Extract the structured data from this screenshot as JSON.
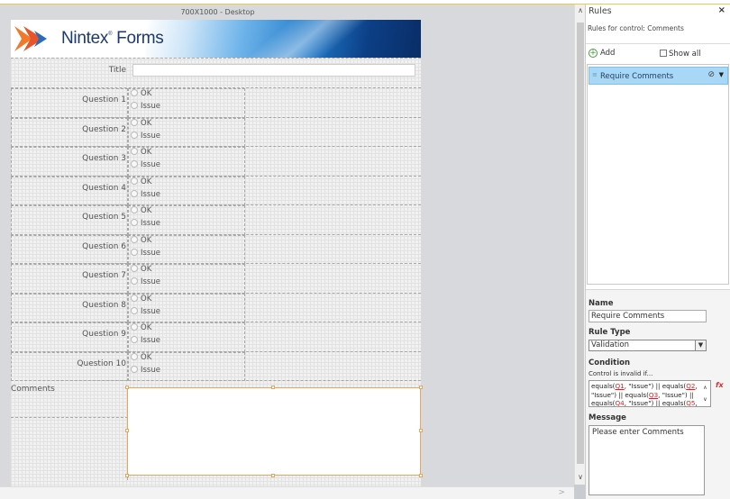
{
  "canvas": {
    "size_label": "700X1000 - Desktop",
    "logo_text": "Nintex",
    "logo_text2": "Forms",
    "logo_tm": "®"
  },
  "form": {
    "title_label": "Title",
    "questions": [
      {
        "label": "Question 1",
        "options": [
          "OK",
          "Issue"
        ]
      },
      {
        "label": "Question 2",
        "options": [
          "OK",
          "Issue"
        ]
      },
      {
        "label": "Question 3",
        "options": [
          "OK",
          "Issue"
        ]
      },
      {
        "label": "Question 4",
        "options": [
          "OK",
          "Issue"
        ]
      },
      {
        "label": "Question 5",
        "options": [
          "OK",
          "Issue"
        ]
      },
      {
        "label": "Question 6",
        "options": [
          "OK",
          "Issue"
        ]
      },
      {
        "label": "Question 7",
        "options": [
          "OK",
          "Issue"
        ]
      },
      {
        "label": "Question 8",
        "options": [
          "OK",
          "Issue"
        ]
      },
      {
        "label": "Question 9",
        "options": [
          "OK",
          "Issue"
        ]
      },
      {
        "label": "Question 10",
        "options": [
          "OK",
          "Issue"
        ]
      }
    ],
    "comments_label": "Comments"
  },
  "panel": {
    "title": "Rules",
    "close": "×",
    "rules_for": "Rules for control: Comments",
    "add_label": "Add",
    "show_all_label": "Show all",
    "rules": [
      {
        "name": "Require Comments"
      }
    ],
    "name_label": "Name",
    "name_value": "Require Comments",
    "rule_type_label": "Rule Type",
    "rule_type_value": "Validation",
    "condition_label": "Condition",
    "condition_hint": "Control is invalid if...",
    "condition_parts": [
      {
        "t": "equals(",
        "ref": false
      },
      {
        "t": "Q1",
        "ref": true
      },
      {
        "t": ", \"Issue\") || equals(",
        "ref": false
      },
      {
        "t": "Q2",
        "ref": true
      },
      {
        "t": ", \"Issue\") || equals(",
        "ref": false
      },
      {
        "t": "Q3",
        "ref": true
      },
      {
        "t": ", \"Issue\") || equals(",
        "ref": false
      },
      {
        "t": "Q4",
        "ref": true
      },
      {
        "t": ", \"Issue\") || equals(",
        "ref": false
      },
      {
        "t": "Q5",
        "ref": true
      },
      {
        "t": ",",
        "ref": false
      }
    ],
    "message_label": "Message",
    "message_value": "Please enter Comments"
  },
  "colors": {
    "accent_orange": "#e6a75a",
    "rule_highlight": "#a9d8f6",
    "reference_red": "#dd2222"
  },
  "icons": {
    "close": "close-icon",
    "add": "add-icon",
    "disable_rule": "disable-icon",
    "rule_menu": "chevron-down-icon",
    "formula": "formula-builder-icon"
  }
}
